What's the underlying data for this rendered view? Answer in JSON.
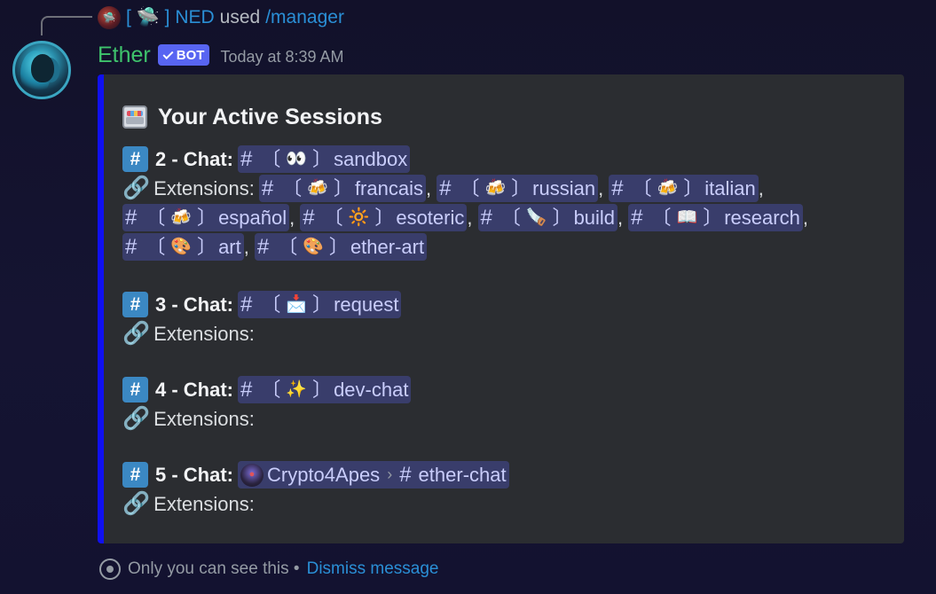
{
  "reply": {
    "user": "[ 🛸 ] NED",
    "used": "used",
    "command": "/manager"
  },
  "message": {
    "username": "Ether",
    "bot_tag": "BOT",
    "timestamp": "Today at 8:39 AM"
  },
  "embed": {
    "title": "Your Active Sessions",
    "border_color": "#1010f0",
    "chat_label_2": "2 - Chat:",
    "chat_label_3": "3 - Chat:",
    "chat_label_4": "4 - Chat:",
    "chat_label_5": "5 - Chat:",
    "extensions_label": "Extensions:",
    "hash": "#",
    "bracket_open": "〔",
    "bracket_close": "〕",
    "comma": ",",
    "chat2": {
      "emoji": "👀",
      "name": "sandbox"
    },
    "ext2": [
      {
        "emoji": "🍻",
        "name": "francais"
      },
      {
        "emoji": "🍻",
        "name": "russian"
      },
      {
        "emoji": "🍻",
        "name": "italian"
      },
      {
        "emoji": "🍻",
        "name": "español"
      },
      {
        "emoji": "🔆",
        "name": "esoteric"
      },
      {
        "emoji": "🪚",
        "name": "build"
      },
      {
        "emoji": "📖",
        "name": "research"
      },
      {
        "emoji": "🎨",
        "name": "art"
      },
      {
        "emoji": "🎨",
        "name": "ether-art"
      }
    ],
    "chat3": {
      "emoji": "📩",
      "name": "request"
    },
    "chat4": {
      "emoji": "✨",
      "name": "dev-chat"
    },
    "chat5": {
      "guild": "Crypto4Apes",
      "arrow": "›",
      "name": "ether-chat"
    }
  },
  "footer": {
    "notice": "Only you can see this •",
    "dismiss": "Dismiss message"
  },
  "colors": {
    "username": "#3ec36c",
    "bot_tag": "#5865f2",
    "link": "#2a8fd6",
    "hash_emoji": "#3b88c3"
  }
}
